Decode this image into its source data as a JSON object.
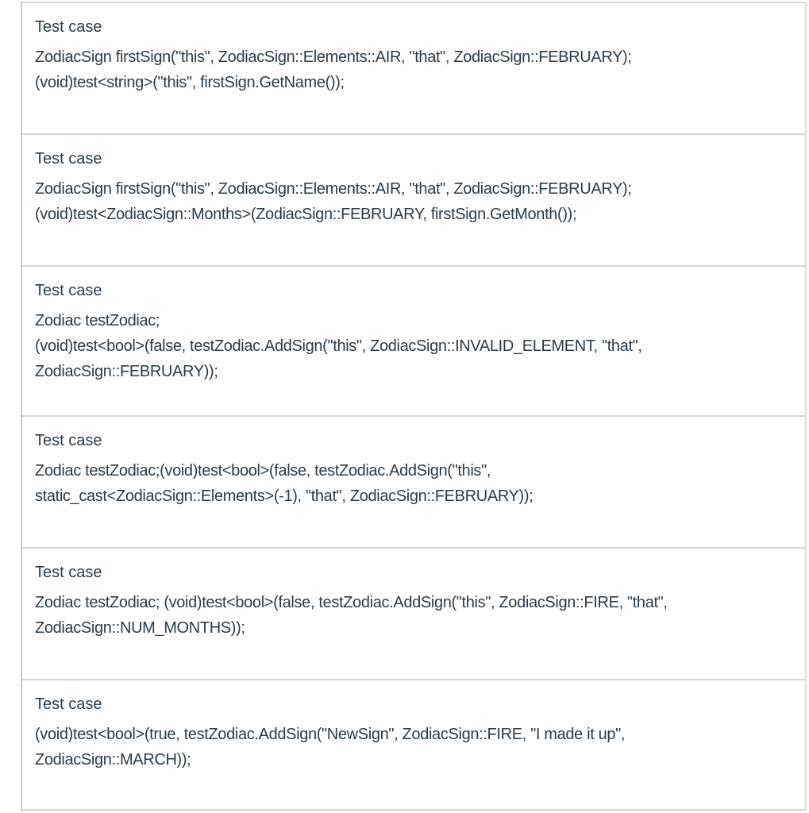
{
  "test_cases": [
    {
      "title": "Test case",
      "lines": [
        "ZodiacSign firstSign(\"this\", ZodiacSign::Elements::AIR, \"that\", ZodiacSign::FEBRUARY);",
        "(void)test<string>(\"this\", firstSign.GetName());"
      ]
    },
    {
      "title": "Test case",
      "lines": [
        "ZodiacSign firstSign(\"this\", ZodiacSign::Elements::AIR, \"that\", ZodiacSign::FEBRUARY);",
        "(void)test<ZodiacSign::Months>(ZodiacSign::FEBRUARY, firstSign.GetMonth());"
      ]
    },
    {
      "title": "Test case",
      "lines": [
        "Zodiac testZodiac;",
        "(void)test<bool>(false, testZodiac.AddSign(\"this\", ZodiacSign::INVALID_ELEMENT, \"that\",",
        "ZodiacSign::FEBRUARY));"
      ]
    },
    {
      "title": "Test case",
      "lines": [
        "Zodiac testZodiac;(void)test<bool>(false, testZodiac.AddSign(\"this\",",
        "static_cast<ZodiacSign::Elements>(-1), \"that\", ZodiacSign::FEBRUARY));"
      ]
    },
    {
      "title": "Test case",
      "lines": [
        "Zodiac testZodiac; (void)test<bool>(false, testZodiac.AddSign(\"this\", ZodiacSign::FIRE, \"that\",",
        "ZodiacSign::NUM_MONTHS));"
      ]
    },
    {
      "title": "Test case",
      "lines": [
        "(void)test<bool>(true, testZodiac.AddSign(\"NewSign\", ZodiacSign::FIRE, \"I made it up\",",
        "ZodiacSign::MARCH));"
      ]
    }
  ]
}
